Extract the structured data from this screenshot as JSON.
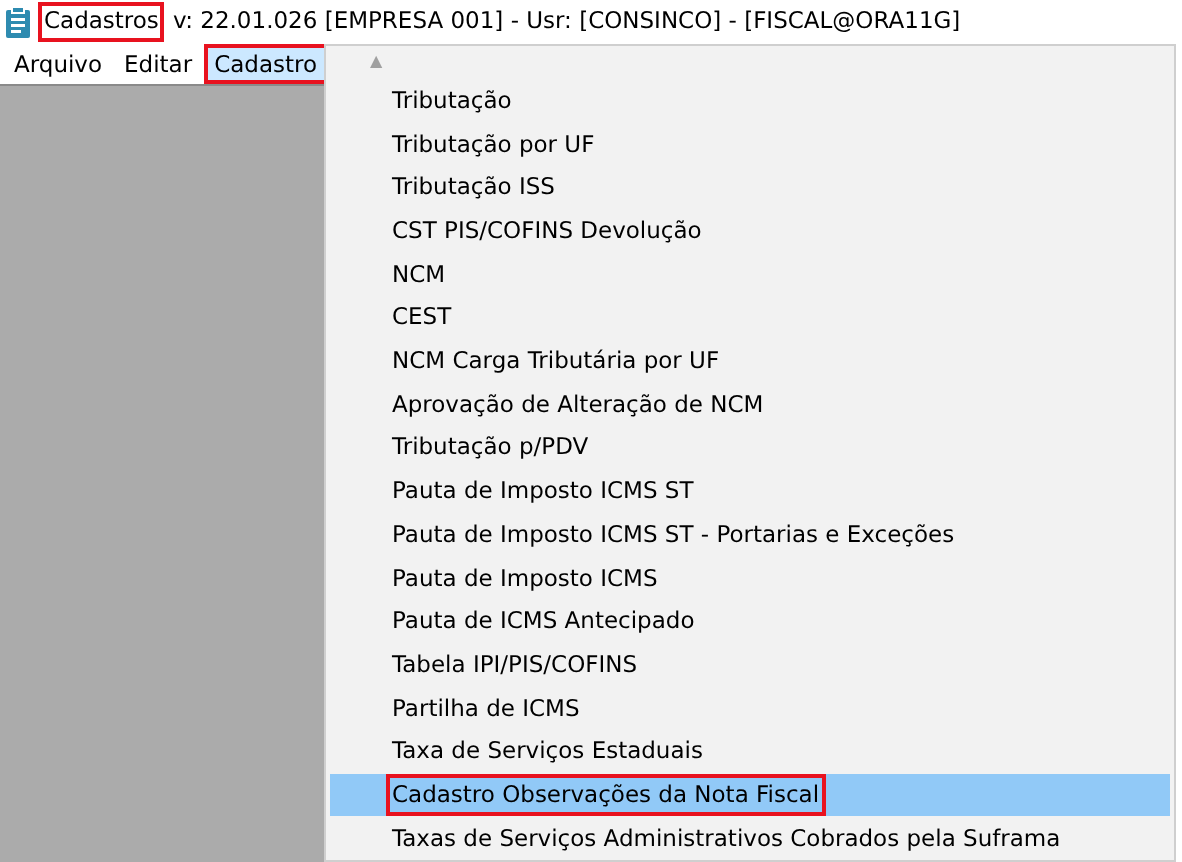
{
  "window": {
    "app_name": "Cadastros",
    "app_name_annotated": true,
    "title": "v: 22.01.026  [EMPRESA 001] - Usr: [CONSINCO] - [FISCAL@ORA11G]"
  },
  "menu_bar": [
    {
      "label": "Arquivo",
      "selected": false,
      "annotated": false
    },
    {
      "label": "Editar",
      "selected": false,
      "annotated": false
    },
    {
      "label": "Cadastro",
      "selected": true,
      "annotated": true
    }
  ],
  "dropdown": {
    "scroll_up": "▲",
    "items": [
      {
        "label": "Tributação",
        "selected": false,
        "annotated": false
      },
      {
        "label": "Tributação por UF",
        "selected": false,
        "annotated": false
      },
      {
        "label": "Tributação ISS",
        "selected": false,
        "annotated": false
      },
      {
        "label": "CST PIS/COFINS Devolução",
        "selected": false,
        "annotated": false
      },
      {
        "label": "NCM",
        "selected": false,
        "annotated": false
      },
      {
        "label": "CEST",
        "selected": false,
        "annotated": false
      },
      {
        "label": "NCM Carga Tributária por UF",
        "selected": false,
        "annotated": false
      },
      {
        "label": "Aprovação de Alteração de NCM",
        "selected": false,
        "annotated": false
      },
      {
        "label": "Tributação p/PDV",
        "selected": false,
        "annotated": false
      },
      {
        "label": "Pauta de Imposto ICMS ST",
        "selected": false,
        "annotated": false
      },
      {
        "label": "Pauta de Imposto ICMS ST - Portarias e Exceções",
        "selected": false,
        "annotated": false
      },
      {
        "label": "Pauta de Imposto ICMS",
        "selected": false,
        "annotated": false
      },
      {
        "label": "Pauta de ICMS Antecipado",
        "selected": false,
        "annotated": false
      },
      {
        "label": "Tabela IPI/PIS/COFINS",
        "selected": false,
        "annotated": false
      },
      {
        "label": "Partilha de ICMS",
        "selected": false,
        "annotated": false
      },
      {
        "label": "Taxa de Serviços Estaduais",
        "selected": false,
        "annotated": false
      },
      {
        "label": "Cadastro Observações da Nota Fiscal",
        "selected": true,
        "annotated": true
      },
      {
        "label": "Taxas de Serviços Administrativos Cobrados pela Suframa",
        "selected": false,
        "annotated": false
      }
    ]
  }
}
